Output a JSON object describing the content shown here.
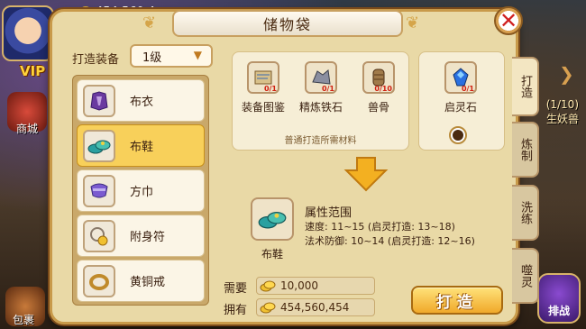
{
  "hud": {
    "vip": "VIP",
    "top_coins": "454,560,4",
    "shop_label": "商城",
    "bag_label": "包裹",
    "battle_label": "排战",
    "quest_line1": "(1/10)",
    "quest_line2": "生妖兽"
  },
  "window": {
    "title": "储物袋"
  },
  "craft": {
    "equip_label": "打造装备",
    "level_value": "1级"
  },
  "items": [
    {
      "name": "布衣",
      "icon": "cloth-armor-icon"
    },
    {
      "name": "布鞋",
      "icon": "cloth-shoes-icon"
    },
    {
      "name": "方巾",
      "icon": "headscarf-icon"
    },
    {
      "name": "附身符",
      "icon": "amulet-icon"
    },
    {
      "name": "黄铜戒",
      "icon": "brass-ring-icon"
    }
  ],
  "materials": {
    "list": [
      {
        "name": "装备图鉴",
        "count": "0/1",
        "icon": "scroll-icon"
      },
      {
        "name": "精炼铁石",
        "count": "0/1",
        "icon": "iron-ore-icon"
      },
      {
        "name": "兽骨",
        "count": "0/10",
        "icon": "bone-icon"
      }
    ],
    "note": "普通打造所需材料",
    "spirit_stone": {
      "name": "启灵石",
      "count": "0/1",
      "icon": "blue-gem-icon"
    }
  },
  "result": {
    "name": "布鞋",
    "attr_title": "属性范围",
    "speed": "速度: 11~15 (启灵打造: 13~18)",
    "mdef": "法术防御: 10~14 (启灵打造: 12~16)"
  },
  "cost": {
    "need_label": "需要",
    "need_value": "10,000",
    "have_label": "拥有",
    "have_value": "454,560,454"
  },
  "craft_button": "打造",
  "tabs": [
    {
      "label": "打造"
    },
    {
      "label": "炼制"
    },
    {
      "label": "洗练"
    },
    {
      "label": "噬灵"
    }
  ]
}
